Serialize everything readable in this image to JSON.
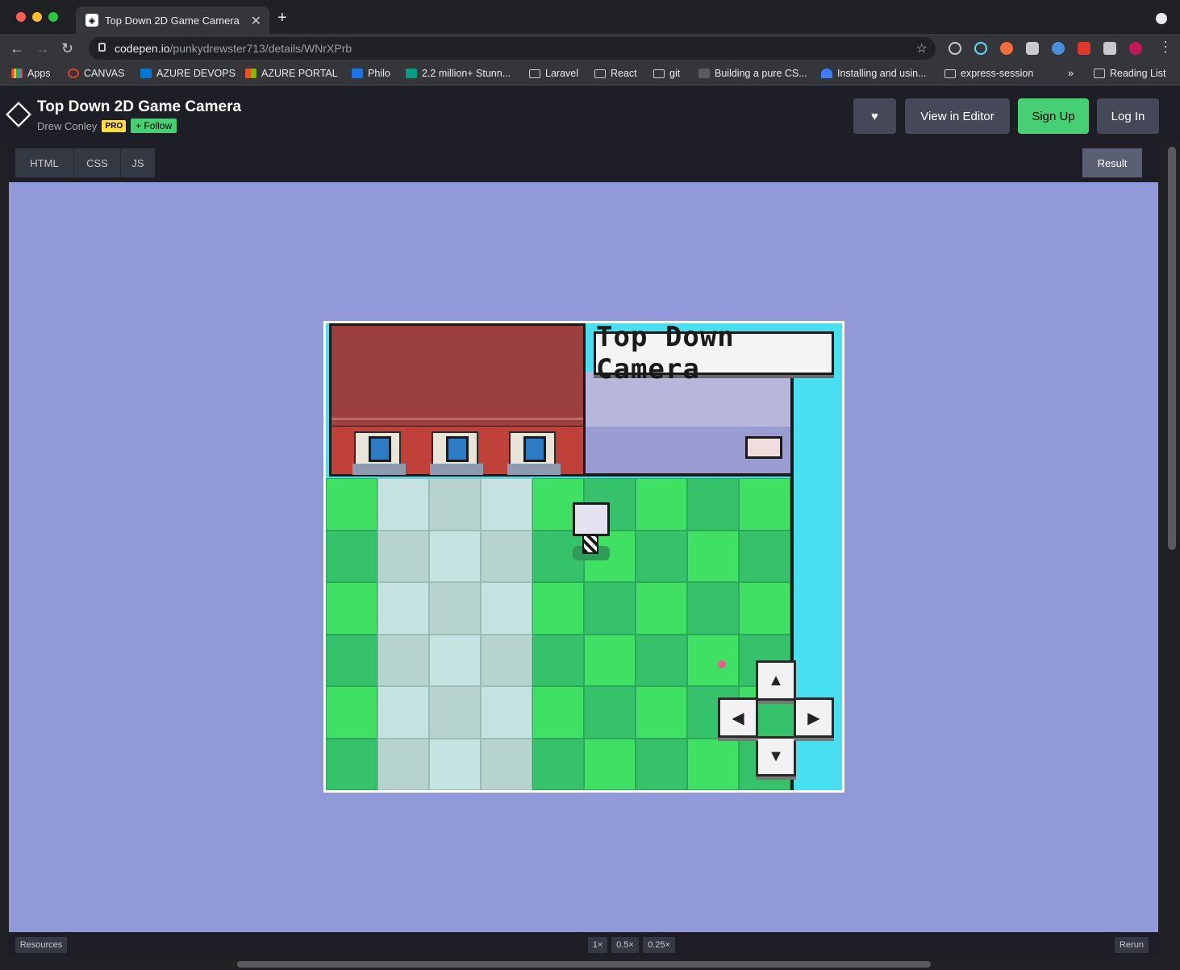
{
  "browser": {
    "tab_title": "Top Down 2D Game Camera",
    "url_host": "codepen.io",
    "url_path": "/punkydrewster713/details/WNrXPrb",
    "bookmarks": [
      "Apps",
      "CANVAS",
      "AZURE DEVOPS",
      "AZURE PORTAL",
      "Philo",
      "2.2 million+ Stunn...",
      "Laravel",
      "React",
      "git",
      "Building a pure CS...",
      "Installing and usin...",
      "express-session"
    ],
    "overflow": "»",
    "reading_list": "Reading List"
  },
  "pen": {
    "title": "Top Down 2D Game Camera",
    "author": "Drew Conley",
    "pro_badge": "PRO",
    "follow_label": "+ Follow",
    "view_in_editor": "View in Editor",
    "sign_up": "Sign Up",
    "log_in": "Log In"
  },
  "editor_tabs": [
    "HTML",
    "CSS",
    "JS"
  ],
  "result_tab": "Result",
  "game": {
    "sign_text": "Top Down Camera",
    "dpad": {
      "up": "▲",
      "down": "▼",
      "left": "◀",
      "right": "▶"
    }
  },
  "footer": {
    "resources": "Resources",
    "zoom": [
      "1×",
      "0.5×",
      "0.25×"
    ],
    "rerun": "Rerun"
  },
  "colors": {
    "result_bg": "#9199d9",
    "grass_light": "#3fe063",
    "grass_dark": "#35c26a",
    "path_light": "#c4e3e0",
    "path_dark": "#b6d3cd",
    "signup_green": "#47cf73"
  }
}
